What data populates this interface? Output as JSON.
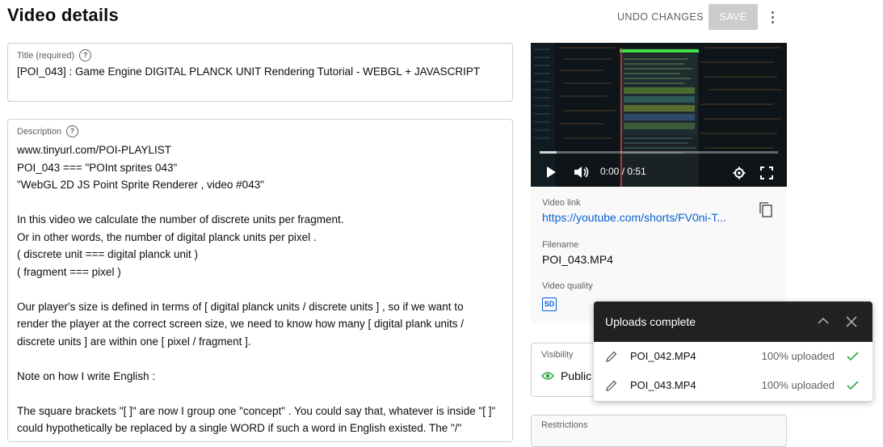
{
  "header": {
    "title": "Video details",
    "undo_label": "UNDO CHANGES",
    "save_label": "SAVE",
    "more_icon": "more-vert-icon"
  },
  "title_field": {
    "label": "Title (required)",
    "value": "[POI_043] : Game Engine DIGITAL PLANCK UNIT Rendering Tutorial - WEBGL + JAVASCRIPT"
  },
  "description": {
    "label": "Description",
    "lines": [
      "www.tinyurl.com/POI-PLAYLIST",
      "POI_043 === \"POInt sprites 043\"",
      "\"WebGL 2D JS Point Sprite Renderer , video #043\"",
      "",
      "In this video we calculate the number of discrete units per fragment.",
      "Or in other words, the number of digital planck units per pixel .",
      "( discrete unit === digital planck unit )",
      "( fragment === pixel )",
      "",
      "Our player's size is defined in terms of [ digital planck units / discrete units ] , so if we want to",
      "render the player at the correct screen size, we need to know how many [ digital plank units /",
      "discrete units ] are within one [ pixel / fragment ].",
      "",
      "Note on how I write English :",
      "",
      "The square brackets \"[ ]\" are now I group one \"concept\" . You could say that, whatever is inside \"[ ]\"",
      "could hypothetically be replaced by a single WORD if such a word in English existed. The \"/\""
    ]
  },
  "player": {
    "time": "0:00 / 0:51",
    "progress": 0.07,
    "icons": [
      "play-icon",
      "volume-icon",
      "settings-icon",
      "fullscreen-icon"
    ]
  },
  "video_info": {
    "link_label": "Video link",
    "link": "https://youtube.com/shorts/FV0ni-T...",
    "filename_label": "Filename",
    "filename": "POI_043.MP4",
    "quality_label": "Video quality",
    "quality_badge": "SD"
  },
  "visibility": {
    "label": "Visibility",
    "value": "Public"
  },
  "restrictions": {
    "label": "Restrictions"
  },
  "uploads": {
    "title": "Uploads complete",
    "items": [
      {
        "name": "POI_042.MP4",
        "status": "100% uploaded"
      },
      {
        "name": "POI_043.MP4",
        "status": "100% uploaded"
      }
    ],
    "colors": {
      "check": "#2ba640",
      "header": "#212121"
    }
  }
}
